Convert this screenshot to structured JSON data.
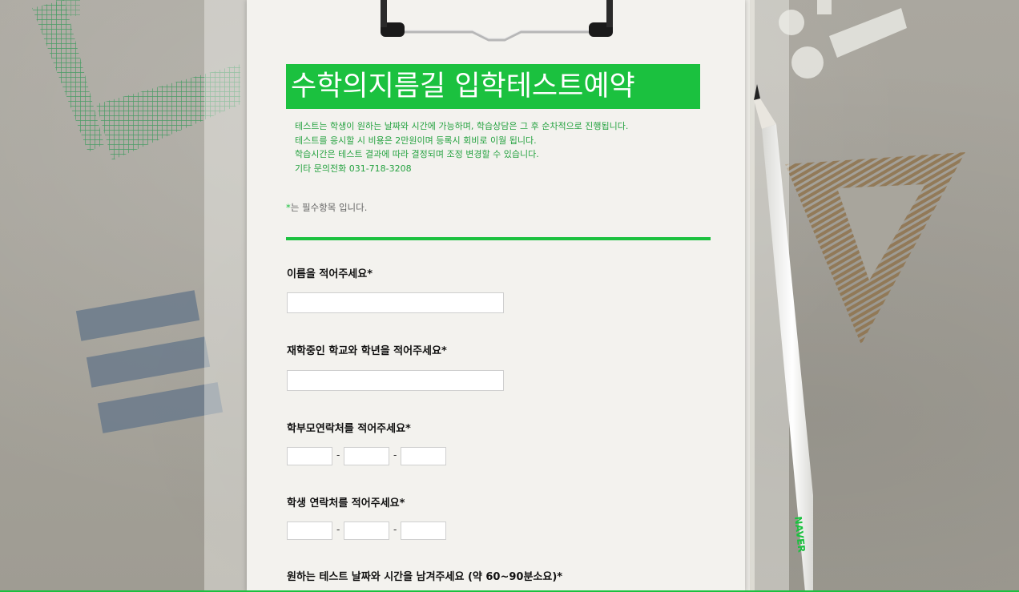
{
  "form": {
    "title": "수학의지름길 입학테스트예약",
    "info_lines": [
      "테스트는 학생이 원하는 날짜와 시간에 가능하며, 학습상담은 그 후 순차적으로 진행됩니다.",
      "테스트를 응시할 시 비용은 2만원이며 등록시 회비로 이월 됩니다.",
      "학습시간은 테스트 결과에 따라 결정되며 조정 변경할 수 있습니다.",
      "기타 문의전화 031-718-3208"
    ],
    "required_star": "*",
    "required_note": "는 필수항목 입니다.",
    "questions": {
      "name": "이름을 적어주세요*",
      "school": "재학중인 학교와 학년을 적어주세요*",
      "parent_phone": "학부모연락처를 적어주세요*",
      "student_phone": "학생 연락처를 적어주세요*",
      "datetime": "원하는 테스트 날짜와 시간을 남겨주세요 (약 60~90분소요)*"
    },
    "phone_separator": "-"
  },
  "pencil_brand": "NAVER",
  "colors": {
    "accent": "#1bc13f",
    "info_text": "#25a240",
    "paper": "#f3f2ee",
    "background": "#a8a59c"
  }
}
